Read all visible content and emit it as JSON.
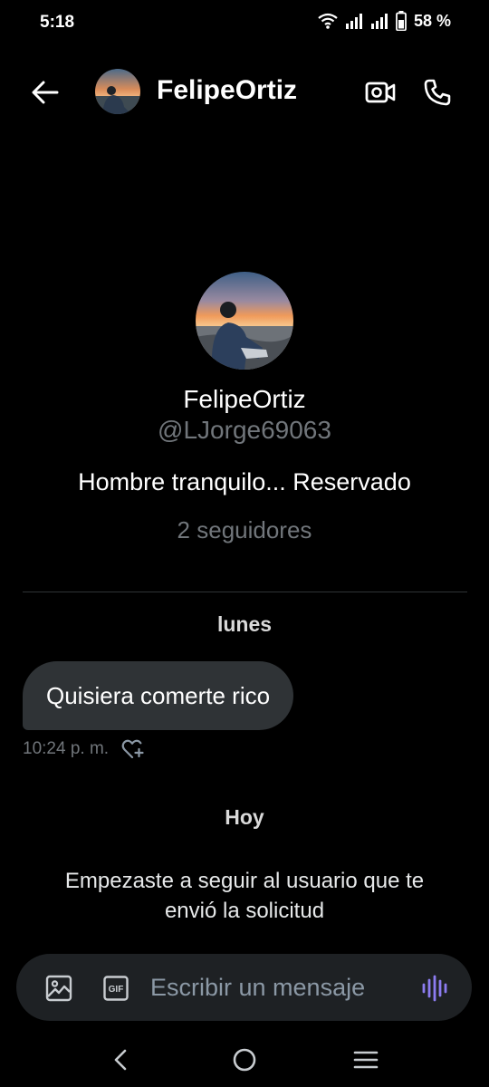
{
  "status_bar": {
    "time": "5:18",
    "battery": "58 %",
    "icons": [
      "wifi-icon",
      "signal-icon",
      "signal-icon",
      "battery-icon"
    ]
  },
  "header": {
    "name": "FelipeOrtiz",
    "back_icon": "arrow-left-icon",
    "video_icon": "video-call-icon",
    "call_icon": "phone-icon"
  },
  "profile": {
    "name": "FelipeOrtiz",
    "handle": "@LJorge69063",
    "bio": "Hombre tranquilo... Reservado",
    "followers": "2 seguidores"
  },
  "conversation": {
    "day_1": "lunes",
    "message_text": "Quisiera comerte rico",
    "message_time": "10:24 p. m.",
    "day_2": "Hoy",
    "system_message": "Empezaste a seguir al usuario que te envió la solicitud"
  },
  "composer": {
    "placeholder": "Escribir un mensaje",
    "media_icon": "image-icon",
    "gif_icon": "gif-icon",
    "voice_icon": "voice-wave-icon"
  },
  "nav": {
    "icons": [
      "nav-back-icon",
      "nav-home-icon",
      "nav-recents-icon"
    ]
  },
  "colors": {
    "background": "#000000",
    "bubble": "#2f3336",
    "secondary_text": "#71767b",
    "composer": "#1e2124",
    "voice_accent": "#8c7cf0"
  }
}
